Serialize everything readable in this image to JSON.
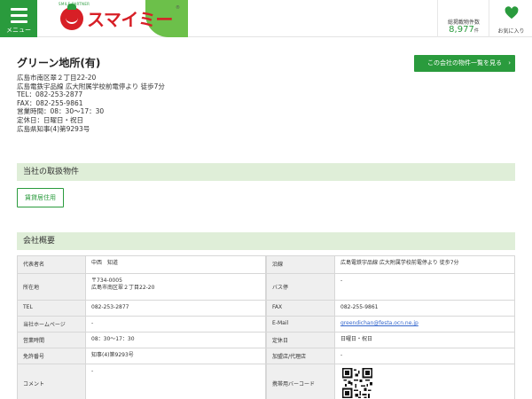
{
  "header": {
    "menu_label": "メニュー",
    "logo_text": "スマイミー",
    "logo_sub": "SMILE PARTNER",
    "logo_reg": "®",
    "count_label": "総掲載物件数",
    "count_value": "8,977",
    "count_unit": "件",
    "fav_label": "お気に入り",
    "brand_color": "#2a9b3d",
    "logo_red": "#d71f26"
  },
  "company": {
    "name": "グリーン地所(有)",
    "lines": [
      "広島市南区翠２丁目22-20",
      "広島電鉄宇品線 広大附属学校前電停より 徒歩7分",
      "TEL：082-253-2877",
      "FAX：082-255-9861",
      "営業時間：08：30～17：30",
      "定休日：日曜日・祝日",
      "広島県知事(4)第9293号"
    ],
    "list_button": "この会社の物件一覧を見る",
    "list_button_arrow": "›"
  },
  "sections": {
    "properties_title": "当社の取扱物件",
    "properties_tag": "賃貸居住用",
    "overview_title": "会社概要"
  },
  "table": {
    "rows": [
      {
        "k1": "代表者名",
        "v1": [
          "中西　知道"
        ],
        "k2": "沿線",
        "v2": [
          "広島電鉄宇品線 広大附属学校前電停より 徒歩7分"
        ]
      },
      {
        "k1": "所在地",
        "v1": [
          "〒734-0005",
          "広島市南区翠２丁目22-20"
        ],
        "k2": "バス停",
        "v2": [
          "-"
        ]
      },
      {
        "k1": "TEL",
        "v1": [
          "082-253-2877"
        ],
        "k2": "FAX",
        "v2": [
          "082-255-9861"
        ]
      },
      {
        "k1": "当社ホームページ",
        "v1": [
          "-"
        ],
        "k2": "E-Mail",
        "v2": [
          "greendichan@festa.ocn.ne.jp"
        ]
      },
      {
        "k1": "営業時間",
        "v1": [
          "08：30～17：30"
        ],
        "k2": "定休日",
        "v2": [
          "日曜日・祝日"
        ]
      },
      {
        "k1": "免許番号",
        "v1": [
          "知事(4)第9293号"
        ],
        "k2": "加盟店/代理店",
        "v2": [
          "-"
        ]
      },
      {
        "k1": "コメント",
        "v1": [
          "-"
        ],
        "k2": "携帯用バーコード",
        "v2": []
      }
    ]
  }
}
